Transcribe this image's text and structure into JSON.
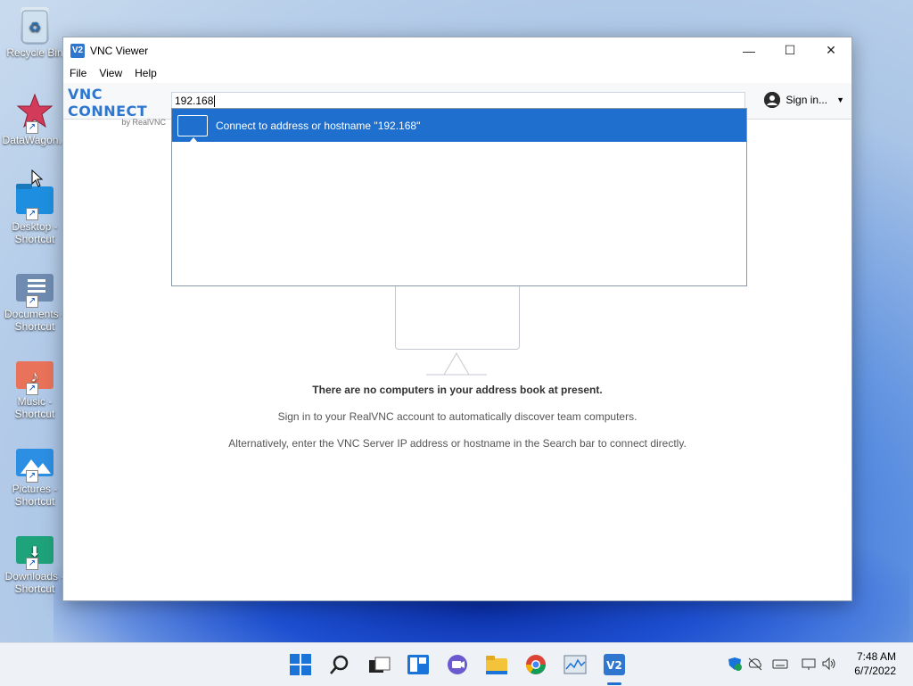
{
  "desktop": {
    "icons": [
      {
        "label": "Recycle Bin"
      },
      {
        "label": "DataWagon..."
      },
      {
        "label": "Desktop - Shortcut"
      },
      {
        "label": "Documents - Shortcut"
      },
      {
        "label": "Music - Shortcut"
      },
      {
        "label": "Pictures - Shortcut"
      },
      {
        "label": "Downloads - Shortcut"
      }
    ]
  },
  "window": {
    "title": "VNC Viewer",
    "controls": {
      "minimize": "—",
      "maximize": "☐",
      "close": "✕"
    },
    "menu": [
      "File",
      "View",
      "Help"
    ],
    "brand": {
      "name": "VNC CONNECT",
      "sub": "by RealVNC"
    },
    "search": {
      "value": "192.168"
    },
    "signin": {
      "label": "Sign in...",
      "caret": "▼"
    },
    "dropdown": {
      "item": "Connect to address or hostname \"192.168\""
    },
    "empty": {
      "line1": "There are no computers in your address book at present.",
      "line2": "Sign in to your RealVNC account to automatically discover team computers.",
      "line3": "Alternatively, enter the VNC Server IP address or hostname in the Search bar to connect directly."
    }
  },
  "taskbar": {
    "apps": [
      "start-icon",
      "search-icon",
      "task-view-icon",
      "widgets-icon",
      "chat-icon",
      "file-explorer-icon",
      "chrome-icon",
      "resource-monitor-icon",
      "vnc-viewer-icon"
    ],
    "clock": {
      "time": "7:48 AM",
      "date": "6/7/2022"
    }
  },
  "colors": {
    "accent": "#1f6fce",
    "brand": "#2f76cf"
  }
}
